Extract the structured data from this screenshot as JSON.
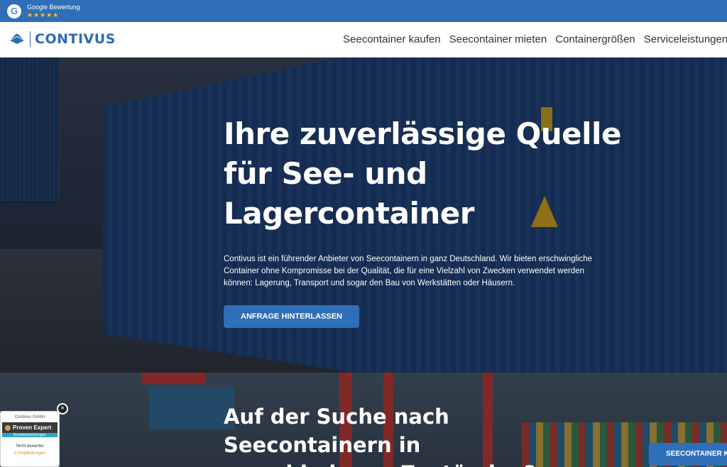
{
  "topbar": {
    "google_letter": "G",
    "rating_label": "Google Bewertung",
    "stars": "★★★★★"
  },
  "nav": {
    "logo_text": "CONTIVUS",
    "menu": [
      "Seecontainer kaufen",
      "Seecontainer mieten",
      "Containergrößen",
      "Serviceleistungen"
    ]
  },
  "hero": {
    "title": "Ihre zuverlässige Quelle für See- und Lagercontainer",
    "text": "Contivus ist ein führender Anbieter von Seecontainern in ganz Deutschland. Wir bieten erschwingliche Container ohne Kompromisse bei der Qualität, die für eine Vielzahl von Zwecken verwendet werden können: Lagerung, Transport und sogar den Bau von Werkstätten oder Häusern.",
    "cta_label": "ANFRAGE HINTERLASSEN"
  },
  "section2": {
    "title": "Auf der Suche nach Seecontainern in verschiedenen Zuständen?",
    "button_label": "SEECONTAINER K"
  },
  "proven_expert": {
    "company": "Contivus GmbH",
    "brand": "Proven Expert",
    "sub": "Kundenbewertungen",
    "status": "Nicht bewertet",
    "recommend": "0 Empfehlungen",
    "close": "×"
  },
  "colors": {
    "brand_blue": "#2f6fb8",
    "logo_blue": "#2b6cb8",
    "star_gold": "#f6c23a"
  }
}
